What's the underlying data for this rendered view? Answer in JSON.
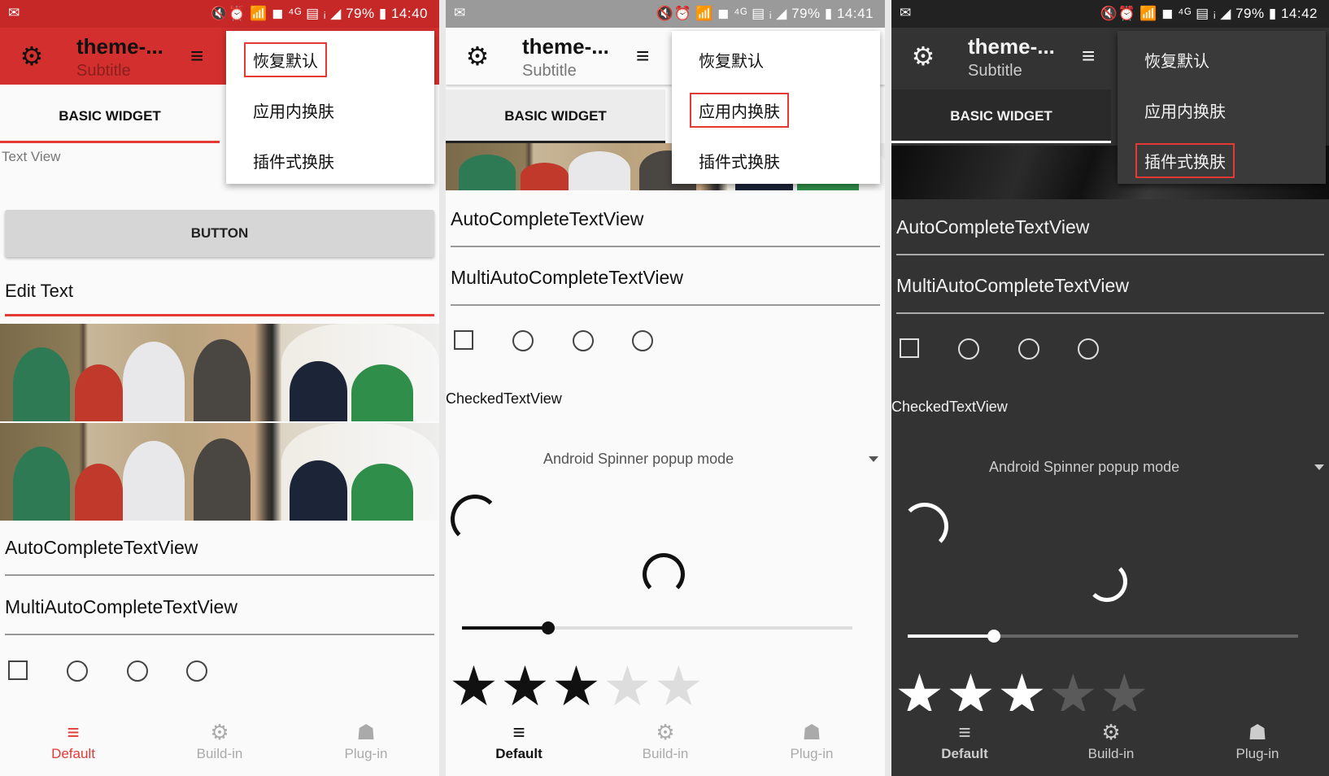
{
  "status": {
    "left_icons": "✉",
    "signal": "🔇⏰ 📶 ◼ ⁴ᴳ ▤ ᵢ ◢ ",
    "battery": "79%",
    "battery_icon": "▮",
    "time_1": "14:40",
    "time_2": "14:41",
    "time_3": "14:42"
  },
  "appbar": {
    "title": "theme-...",
    "subtitle": "Subtitle",
    "gear_icon": "⚙",
    "menu_icon": "≡"
  },
  "menu": {
    "restore": "恢复默认",
    "in_app": "应用内换肤",
    "plugin": "插件式换肤"
  },
  "tab": {
    "basic_widget": "BASIC WIDGET"
  },
  "widgets": {
    "text_view": "Text View",
    "button": "BUTTON",
    "edit_text": "Edit Text",
    "auto_complete": "AutoCompleteTextView",
    "multi_auto_complete": "MultiAutoCompleteTextView",
    "checked_text_view": "CheckedTextView",
    "spinner": "Android Spinner popup mode"
  },
  "progress": {
    "seek_fraction": 0.22
  },
  "rating": {
    "value": 3,
    "max": 5,
    "star": "★"
  },
  "bottom_nav": {
    "default": "Default",
    "build_in": "Build-in",
    "plug_in": "Plug-in",
    "default_icon": "≡",
    "build_in_icon": "⚙",
    "plug_in_icon": "☗"
  },
  "colors": {
    "red": "#d32f2f",
    "highlight": "#e53935",
    "dark": "#333333"
  }
}
